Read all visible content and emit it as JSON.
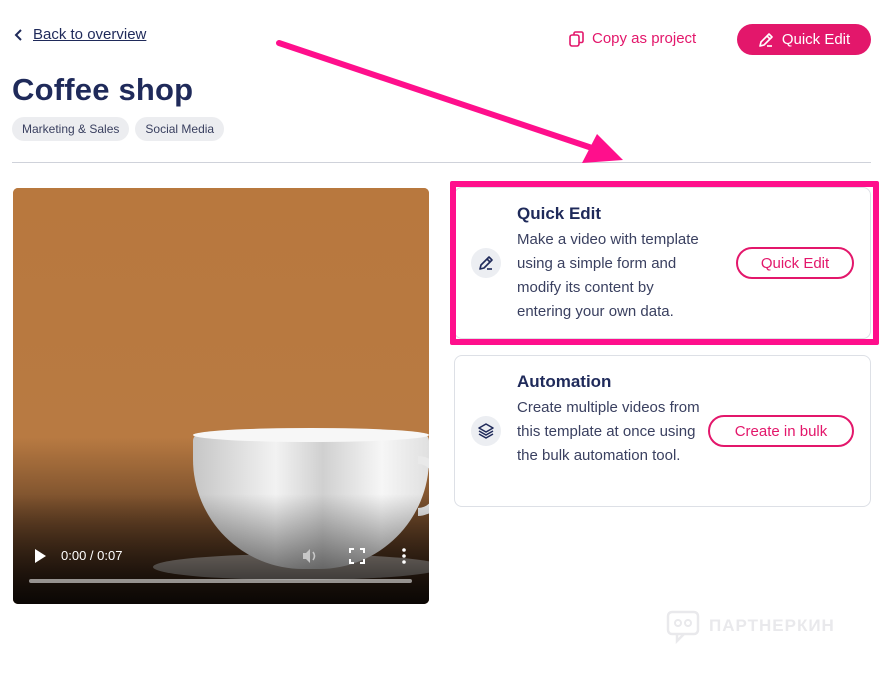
{
  "header": {
    "back_label": "Back to overview",
    "copy_label": "Copy as project",
    "quick_edit_label": "Quick Edit"
  },
  "page": {
    "title": "Coffee shop",
    "tags": [
      "Marketing & Sales",
      "Social Media"
    ]
  },
  "video": {
    "time": "0:00 / 0:07",
    "progress": 0
  },
  "cards": {
    "quick_edit": {
      "title": "Quick Edit",
      "description": "Make a video with template using a simple form and modify its content by entering your own data.",
      "button": "Quick Edit"
    },
    "automation": {
      "title": "Automation",
      "description": "Create multiple videos from this template at once using the bulk automation tool.",
      "button": "Create in bulk"
    }
  },
  "watermark": {
    "text": "ПАРТНЕРКИН"
  },
  "colors": {
    "accent": "#e3176b",
    "highlight": "#ff0f8c",
    "title": "#1f2a5a"
  }
}
